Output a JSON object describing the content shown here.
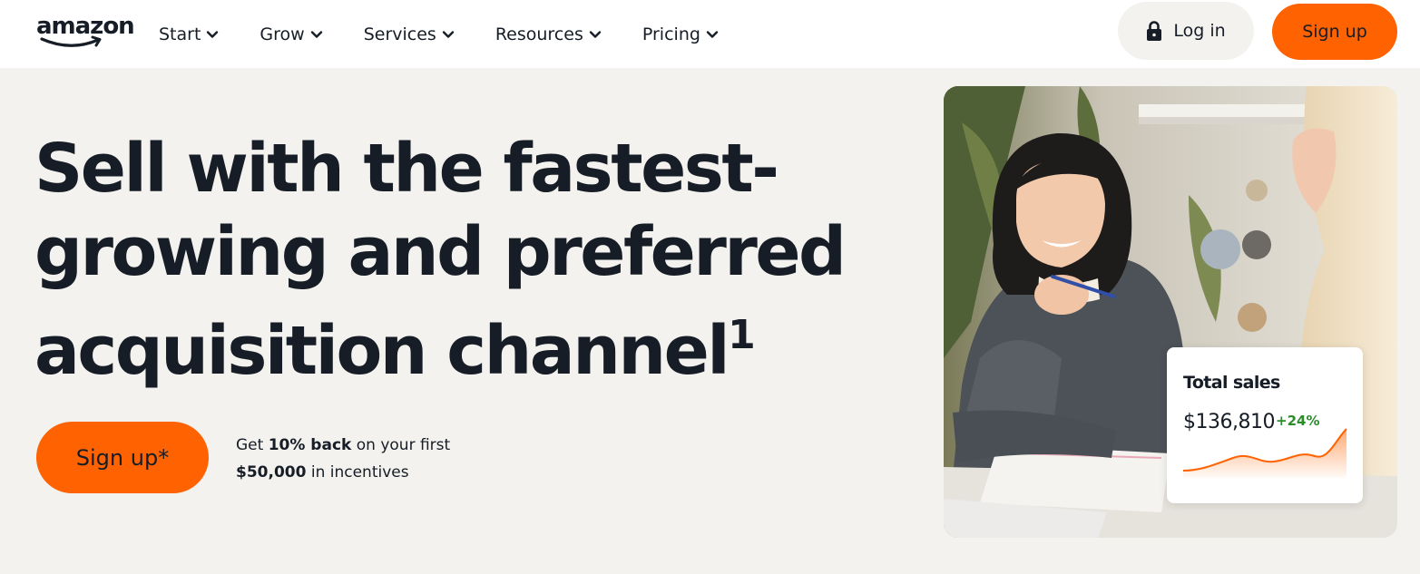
{
  "header": {
    "logo_text": "amazon",
    "nav": [
      {
        "label": "Start"
      },
      {
        "label": "Grow"
      },
      {
        "label": "Services"
      },
      {
        "label": "Resources"
      },
      {
        "label": "Pricing"
      }
    ],
    "login_label": "Log in",
    "signup_label": "Sign up"
  },
  "hero": {
    "title_lines": [
      "Sell with the fastest-",
      "growing and preferred",
      "acquisition channel"
    ],
    "title_footnote": "1",
    "cta_label": "Sign up*",
    "incentive": {
      "pre": "Get ",
      "bold1": "10% back",
      "mid": " on your first",
      "bold2": "$50,000",
      "post": " in incentives"
    }
  },
  "sales_card": {
    "label": "Total sales",
    "value": "$136,810",
    "change": "+24%"
  },
  "colors": {
    "accent": "#ff6200",
    "background": "#f3f2ee",
    "text": "#161d26",
    "positive": "#2d8a2d"
  },
  "icons": {
    "login": "lock-icon",
    "nav_dropdown": "chevron-down-icon"
  }
}
